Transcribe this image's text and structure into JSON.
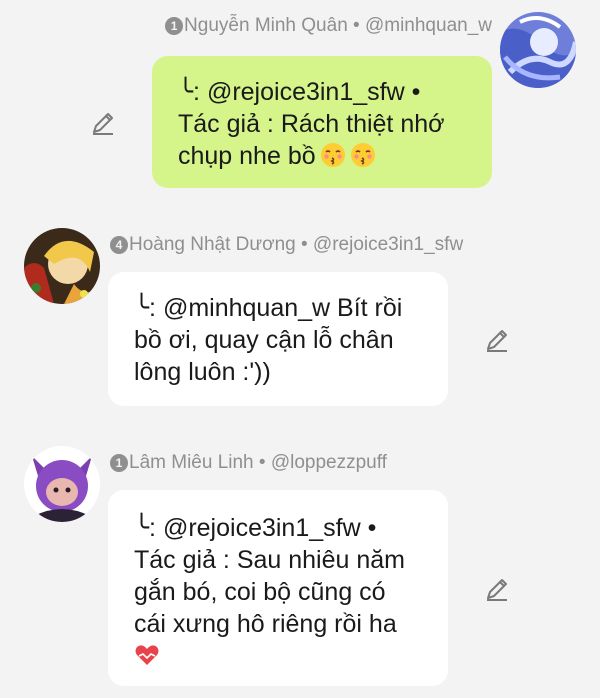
{
  "messages": [
    {
      "header": {
        "badge": "1",
        "author": "Nguyễn Minh Quân • @minhquan_w"
      },
      "lines": [
        "╰: @rejoice3in1_sfw •",
        "Tác giả : Rách thiệt nhớ",
        "chụp nhe bồ"
      ],
      "emojis": [
        "kissing-closed-eyes-emoji",
        "kissing-closed-eyes-emoji"
      ]
    },
    {
      "header": {
        "badge": "4",
        "author": "Hoàng Nhật Dương • @rejoice3in1_sfw"
      },
      "lines": [
        "╰: @minhquan_w Bít rồi",
        "bồ ơi, quay cận lỗ chân",
        "lông luôn :'))"
      ]
    },
    {
      "header": {
        "badge": "1",
        "author": "Lâm Miêu Linh • @loppezzpuff"
      },
      "lines": [
        "╰: @rejoice3in1_sfw •",
        "Tác giả : Sau nhiêu năm",
        "gắn bó, coi bộ cũng có",
        "cái xưng hô riêng rồi ha"
      ],
      "emojis": [
        "heart-emoji"
      ]
    }
  ],
  "colors": {
    "own_bubble": "#d5f48a",
    "other_bubble": "#ffffff",
    "meta_text": "#8f8f8f",
    "background": "#f3f3f3"
  },
  "icons": {
    "edit": "pencil-icon"
  }
}
